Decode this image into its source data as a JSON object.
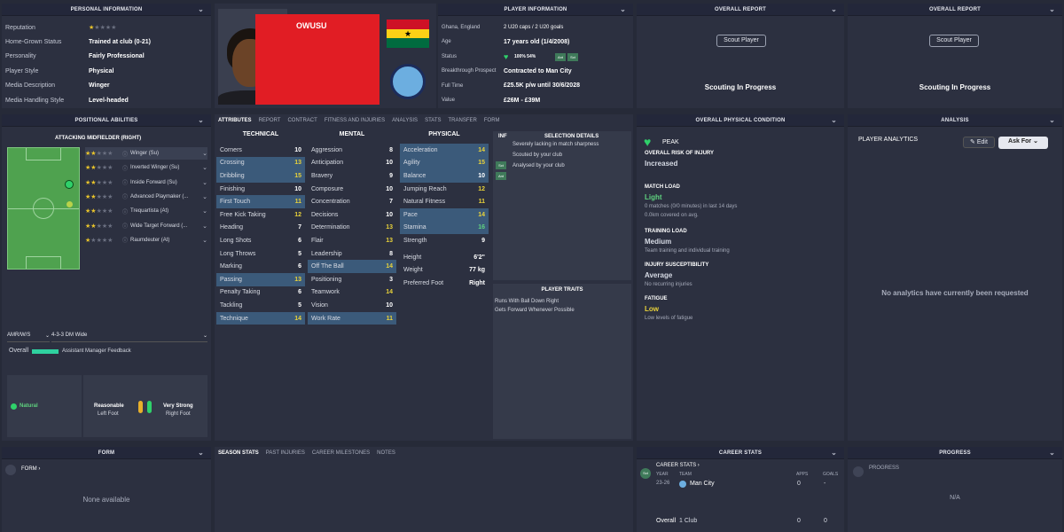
{
  "personal": {
    "header": "PERSONAL INFORMATION",
    "rows": [
      {
        "label": "Reputation",
        "value": ""
      },
      {
        "label": "Home-Grown Status",
        "value": "Trained at club (0-21)"
      },
      {
        "label": "Personality",
        "value": "Fairly Professional"
      },
      {
        "label": "Player Style",
        "value": "Physical"
      },
      {
        "label": "Media Description",
        "value": "Winger"
      },
      {
        "label": "Media Handling Style",
        "value": "Level-headed"
      }
    ]
  },
  "player": {
    "name": "OWUSU"
  },
  "playerinfo": {
    "header": "PLAYER INFORMATION",
    "rows": [
      {
        "label": "Ghana, England",
        "value": "2 U20 caps / 2 U20 goals"
      },
      {
        "label": "Age",
        "value": "17 years old (1/4/2008)"
      },
      {
        "label": "Status",
        "value": "100%   54%"
      },
      {
        "label": "Breakthrough Prospect",
        "value": "Contracted to Man City"
      },
      {
        "label": "Full Time",
        "value": "£25.5K p/w until 30/6/2028"
      },
      {
        "label": "Value",
        "value": "£26M - £39M"
      }
    ],
    "status_badges": [
      "Ant",
      "Sct"
    ]
  },
  "overall1": {
    "header": "OVERALL REPORT",
    "button": "Scout Player",
    "status": "Scouting In Progress"
  },
  "overall2": {
    "header": "OVERALL REPORT",
    "button": "Scout Player",
    "status": "Scouting In Progress"
  },
  "positional": {
    "header": "POSITIONAL ABILITIES",
    "subheader": "ATTACKING MIDFIELDER (RIGHT)",
    "roles": [
      {
        "name": "Winger (Su)",
        "stars": 2
      },
      {
        "name": "Inverted Winger (Su)",
        "stars": 2
      },
      {
        "name": "Inside Forward (Su)",
        "stars": 1.5
      },
      {
        "name": "Advanced Playmaker (...",
        "stars": 1.5
      },
      {
        "name": "Trequartista (At)",
        "stars": 1.5
      },
      {
        "name": "Wide Target Forward (...",
        "stars": 1.5
      },
      {
        "name": "Raumdeuter (At)",
        "stars": 1
      }
    ],
    "position_select": "AMR/W/S",
    "formation_select": "4-3-3 DM Wide",
    "overall_label": "Overall",
    "feedback": "Assistant Manager Feedback",
    "natural": "Natural",
    "left_foot_rating": "Reasonable",
    "left_foot_label": "Left Foot",
    "right_foot_rating": "Very Strong",
    "right_foot_label": "Right Foot"
  },
  "tabs": [
    "ATTRIBUTES",
    "REPORT",
    "CONTRACT",
    "FITNESS AND INJURIES",
    "ANALYSIS",
    "STATS",
    "TRANSFER",
    "FORM"
  ],
  "technical": {
    "header": "TECHNICAL",
    "rows": [
      {
        "name": "Corners",
        "v": "10",
        "hi": false
      },
      {
        "name": "Crossing",
        "v": "13",
        "hi": true
      },
      {
        "name": "Dribbling",
        "v": "15",
        "hi": true
      },
      {
        "name": "Finishing",
        "v": "10",
        "hi": false
      },
      {
        "name": "First Touch",
        "v": "11",
        "hi": true
      },
      {
        "name": "Free Kick Taking",
        "v": "12",
        "hi": false
      },
      {
        "name": "Heading",
        "v": "7",
        "hi": false
      },
      {
        "name": "Long Shots",
        "v": "6",
        "hi": false
      },
      {
        "name": "Long Throws",
        "v": "5",
        "hi": false
      },
      {
        "name": "Marking",
        "v": "6",
        "hi": false
      },
      {
        "name": "Passing",
        "v": "13",
        "hi": true
      },
      {
        "name": "Penalty Taking",
        "v": "6",
        "hi": false
      },
      {
        "name": "Tackling",
        "v": "5",
        "hi": false
      },
      {
        "name": "Technique",
        "v": "14",
        "hi": true
      }
    ]
  },
  "mental": {
    "header": "MENTAL",
    "rows": [
      {
        "name": "Aggression",
        "v": "8",
        "hi": false
      },
      {
        "name": "Anticipation",
        "v": "10",
        "hi": false
      },
      {
        "name": "Bravery",
        "v": "9",
        "hi": false
      },
      {
        "name": "Composure",
        "v": "10",
        "hi": false
      },
      {
        "name": "Concentration",
        "v": "7",
        "hi": false
      },
      {
        "name": "Decisions",
        "v": "10",
        "hi": false
      },
      {
        "name": "Determination",
        "v": "13",
        "hi": false
      },
      {
        "name": "Flair",
        "v": "13",
        "hi": false
      },
      {
        "name": "Leadership",
        "v": "8",
        "hi": false
      },
      {
        "name": "Off The Ball",
        "v": "14",
        "hi": true
      },
      {
        "name": "Positioning",
        "v": "3",
        "hi": false
      },
      {
        "name": "Teamwork",
        "v": "14",
        "hi": false
      },
      {
        "name": "Vision",
        "v": "10",
        "hi": false
      },
      {
        "name": "Work Rate",
        "v": "11",
        "hi": true
      }
    ]
  },
  "physical": {
    "header": "PHYSICAL",
    "rows": [
      {
        "name": "Acceleration",
        "v": "14",
        "hi": true
      },
      {
        "name": "Agility",
        "v": "15",
        "hi": true
      },
      {
        "name": "Balance",
        "v": "10",
        "hi": true
      },
      {
        "name": "Jumping Reach",
        "v": "12",
        "hi": false
      },
      {
        "name": "Natural Fitness",
        "v": "11",
        "hi": false
      },
      {
        "name": "Pace",
        "v": "14",
        "hi": true
      },
      {
        "name": "Stamina",
        "v": "16",
        "hi": true
      },
      {
        "name": "Strength",
        "v": "9",
        "hi": false
      }
    ],
    "height_label": "Height",
    "height": "6'2\"",
    "weight_label": "Weight",
    "weight": "77 kg",
    "foot_label": "Preferred Foot",
    "foot": "Right"
  },
  "selection": {
    "inf_header": "INF",
    "header": "SELECTION DETAILS",
    "items": [
      {
        "badge": "",
        "text": "Severely lacking in match sharpness"
      },
      {
        "badge": "Sct",
        "text": "Scouted by your club"
      },
      {
        "badge": "Ant",
        "text": "Analysed by your club"
      }
    ]
  },
  "traits": {
    "header": "PLAYER TRAITS",
    "items": [
      "Runs With Ball Down Right",
      "Gets Forward Whenever Possible"
    ]
  },
  "condition": {
    "header": "OVERALL PHYSICAL CONDITION",
    "peak": "PEAK",
    "items": [
      {
        "label": "OVERALL RISK OF INJURY",
        "value": "Increased",
        "color": "#d6dae4",
        "note": ""
      },
      {
        "label": "MATCH LOAD",
        "value": "Light",
        "color": "#5fd27f",
        "note": "0 matches (0/0 minutes) in last 14 days\n0.0km covered on avg."
      },
      {
        "label": "TRAINING LOAD",
        "value": "Medium",
        "color": "#d6dae4",
        "note": "Team training and individual training"
      },
      {
        "label": "INJURY SUSCEPTIBILITY",
        "value": "Average",
        "color": "#d6dae4",
        "note": "No recurring injuries"
      },
      {
        "label": "FATIGUE",
        "value": "Low",
        "color": "#e8d23a",
        "note": "Low levels of fatigue"
      }
    ]
  },
  "analysis": {
    "header": "ANALYSIS",
    "title": "PLAYER ANALYTICS",
    "edit": "Edit",
    "askfor": "Ask For",
    "empty": "No analytics have currently been requested"
  },
  "form": {
    "header": "FORM",
    "sub": "FORM",
    "empty": "None available"
  },
  "bottomtabs": [
    "SEASON STATS",
    "PAST INJURIES",
    "CAREER MILESTONES",
    "NOTES"
  ],
  "career": {
    "header": "CAREER STATS",
    "sub": "CAREER STATS",
    "cols": [
      "YEAR",
      "TEAM",
      "APPS",
      "GOALS"
    ],
    "row": {
      "year": "23-26",
      "team": "Man City",
      "apps": "0",
      "goals": "-"
    },
    "total": {
      "label": "Overall",
      "team": "1 Club",
      "apps": "0",
      "goals": "0"
    }
  },
  "progress": {
    "header": "PROGRESS",
    "sub": "PROGRESS",
    "empty": "N/A"
  },
  "colors": {
    "accent": "#e8c32b",
    "green": "#5fd27f",
    "highlight": "#3b5a7a",
    "panel": "#2c3040"
  }
}
